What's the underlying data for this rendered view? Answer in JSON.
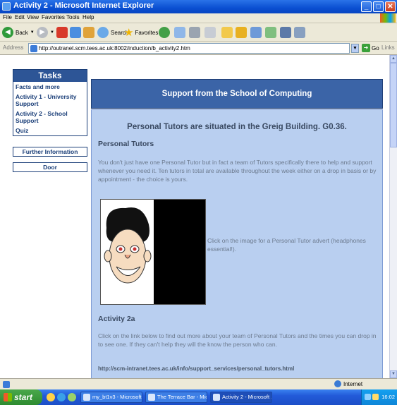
{
  "window": {
    "title": "Activity 2 - Microsoft Internet Explorer",
    "controls": [
      "_",
      "□",
      "✕"
    ]
  },
  "menu": [
    "File",
    "Edit",
    "View",
    "Favorites",
    "Tools",
    "Help"
  ],
  "toolbar": {
    "back_label": "Back",
    "search_label": "Search",
    "favorites_label": "Favorites"
  },
  "address": {
    "label": "Address",
    "url": "http://outranet.scm.tees.ac.uk:8002/induction/b_activity2.htm",
    "go_label": "Go",
    "links_label": "Links"
  },
  "nav": {
    "tasks_title": "Tasks",
    "items": [
      "Facts and more",
      "Activity 1 - University Support",
      "Activity 2 - School Support",
      "Quiz"
    ],
    "further_info": "Further Information",
    "door": "Door"
  },
  "main": {
    "header": "Support from the School of Computing",
    "location_heading": "Personal Tutors are situated in the Greig Building. G0.36.",
    "section_heading": "Personal Tutors",
    "intro": "You don't just have one Personal Tutor but in fact a team of Tutors specifically there to help and support whenever you need it. Ten tutors in total are available throughout the week either on a drop in basis or by appointment - the choice is yours.",
    "image_caption": "Click on the image for a Personal Tutor advert (headphones essential!).",
    "activity_heading": "Activity 2a",
    "activity_text": "Click on the link below to find out more about your team of Personal Tutors and the times you can drop in to see one. If they can't help they will the know the person who can.",
    "link_url": "http://scm-intranet.tees.ac.uk/info/support_services/personal_tutors.html"
  },
  "status": {
    "zone": "Internet"
  },
  "taskbar": {
    "start_label": "start",
    "tasks": [
      "my_bt1v3 - Microsoft...",
      "The Terrace Bar - Mic...",
      "Activity 2 - Microsoft ..."
    ],
    "clock": "16:02"
  }
}
